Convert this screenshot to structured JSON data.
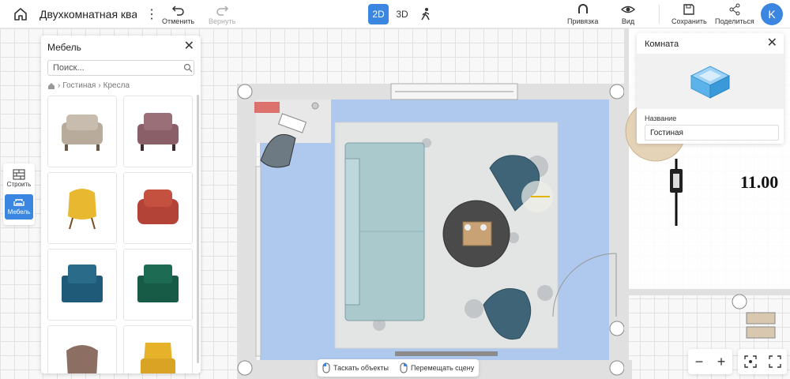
{
  "header": {
    "project_title": "Двухкомнатная квар",
    "undo_label": "Отменить",
    "redo_label": "Вернуть",
    "modes": [
      {
        "label": "2D",
        "active": true
      },
      {
        "label": "3D",
        "active": false
      }
    ],
    "walk_icon": "walk-icon",
    "snap_label": "Привязка",
    "view_label": "Вид",
    "save_label": "Сохранить",
    "share_label": "Поделиться",
    "avatar_letter": "K"
  },
  "rail": {
    "build_label": "Строить",
    "furniture_label": "Мебель"
  },
  "furniture_panel": {
    "title": "Мебель",
    "search_placeholder": "Поиск...",
    "breadcrumb": [
      "Гостиная",
      "Кресла"
    ],
    "items": [
      {
        "name": "beige-sofa-chair",
        "color": "#b8ab9c"
      },
      {
        "name": "mauve-armchair",
        "color": "#8a5f67"
      },
      {
        "name": "yellow-lounge-chair",
        "color": "#e8b830"
      },
      {
        "name": "red-armchair",
        "color": "#b34336"
      },
      {
        "name": "teal-armchair",
        "color": "#1f5b78"
      },
      {
        "name": "green-armchair",
        "color": "#175a45"
      },
      {
        "name": "brown-tub-chair",
        "color": "#8d6e63"
      },
      {
        "name": "yellow-wingback-chair",
        "color": "#e6b22a"
      }
    ]
  },
  "room_panel": {
    "title": "Комната",
    "name_label": "Название",
    "name_value": "Гостиная"
  },
  "canvas": {
    "dimension_label": "11.00"
  },
  "hints": {
    "drag_objects": "Таскать объекты",
    "move_scene": "Перемещать сцену"
  },
  "zoom": {
    "minus": "−",
    "plus": "+"
  },
  "colors": {
    "accent": "#3b86e0",
    "floor": "#aec8ee",
    "sofa": "#a9c9cd",
    "chair": "#3f6478",
    "table": "#4a4a4a"
  }
}
